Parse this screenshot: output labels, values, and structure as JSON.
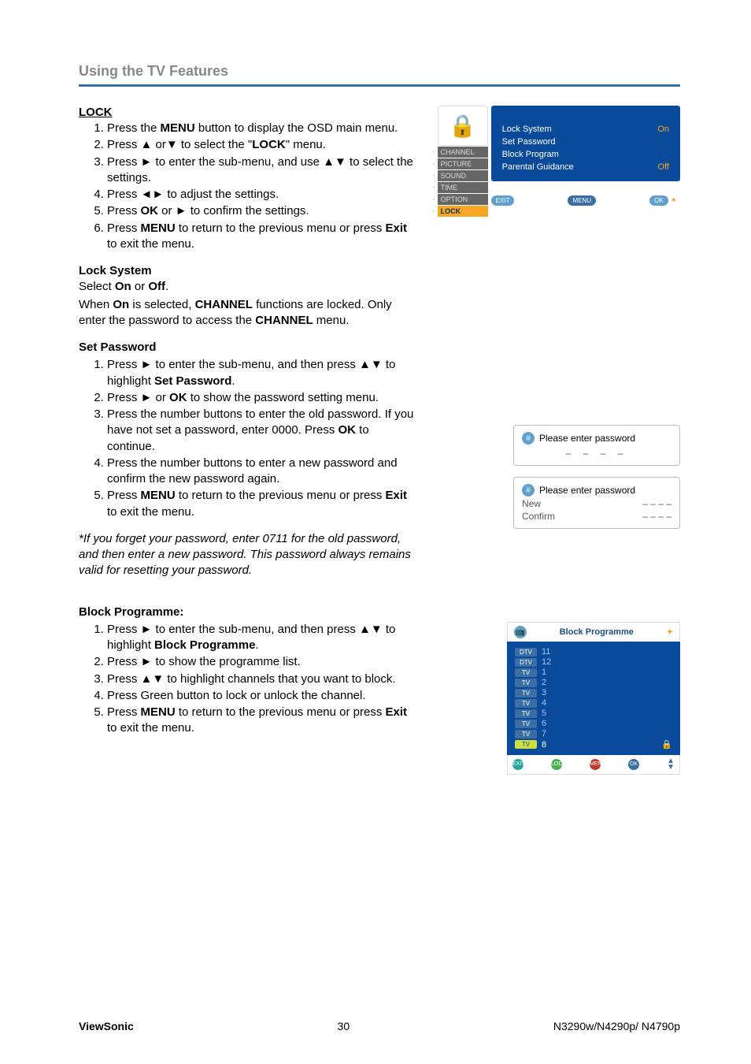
{
  "header": {
    "title": "Using the TV Features"
  },
  "lock": {
    "heading": "LOCK",
    "steps": [
      "Press the MENU button to display the OSD main menu.",
      "Press ▲ or▼ to select the \"LOCK\" menu.",
      "Press ► to enter the sub-menu, and use ▲▼ to select the settings.",
      "Press ◄► to adjust the settings.",
      "Press OK or ► to confirm the settings.",
      "Press MENU to return to the previous menu or press Exit to exit the menu."
    ]
  },
  "lockSystem": {
    "heading": "Lock System",
    "line1": "Select On or Off.",
    "line2": "When On is selected, CHANNEL functions are locked. Only enter the password to access the CHANNEL menu."
  },
  "setPassword": {
    "heading": "Set Password",
    "steps": [
      "Press ► to enter the sub-menu, and then press ▲▼ to highlight Set Password.",
      "Press ► or OK to show the password setting menu.",
      "Press the number buttons to enter the old password. If you have not set a password, enter 0000. Press OK to continue.",
      "Press the number buttons to enter a new password and confirm the new password again.",
      "Press MENU to return to the previous menu or press Exit to exit the menu."
    ],
    "note": "*If you forget your password, enter 0711 for the old password, and then enter a new password. This password always remains valid for resetting your password."
  },
  "blockProgramme": {
    "heading": "Block Programme:",
    "steps": [
      "Press ► to enter the sub-menu, and then press ▲▼ to highlight Block Programme.",
      "Press ► to show the programme list.",
      "Press ▲▼ to highlight channels that you want to block.",
      "Press Green button to lock or unlock the channel.",
      "Press MENU to return to the previous menu or press Exit to exit the menu."
    ]
  },
  "osd": {
    "side": [
      "CHANNEL",
      "PICTURE",
      "SOUND",
      "TIME",
      "OPTION",
      "LOCK"
    ],
    "main": {
      "rows": [
        {
          "label": "Lock System",
          "value": "On"
        },
        {
          "label": "Set Password",
          "value": ""
        },
        {
          "label": "Block Program",
          "value": ""
        },
        {
          "label": "Parental Guidance",
          "value": "Off"
        }
      ]
    },
    "foot": {
      "exit": "EXIT",
      "menu": "MENU",
      "ok": "OK"
    }
  },
  "pw1": {
    "title": "Please enter password",
    "dashes": "– – – –"
  },
  "pw2": {
    "title": "Please enter password",
    "rows": [
      {
        "label": "New",
        "dashes": "– – – –"
      },
      {
        "label": "Confirm",
        "dashes": "– – – –"
      }
    ]
  },
  "bp": {
    "title": "Block Programme",
    "items": [
      {
        "tag": "DTV",
        "num": "11"
      },
      {
        "tag": "DTV",
        "num": "12"
      },
      {
        "tag": "TV",
        "num": "1"
      },
      {
        "tag": "TV",
        "num": "2"
      },
      {
        "tag": "TV",
        "num": "3"
      },
      {
        "tag": "TV",
        "num": "4"
      },
      {
        "tag": "TV",
        "num": "5"
      },
      {
        "tag": "TV",
        "num": "6"
      },
      {
        "tag": "TV",
        "num": "7"
      },
      {
        "tag": "TV",
        "num": "8",
        "active": true,
        "locked": true
      }
    ],
    "foot": {
      "exit": "EXIT",
      "lock": "LOCK",
      "menu": "MENU",
      "ok": "OK"
    }
  },
  "footer": {
    "left": "ViewSonic",
    "center": "30",
    "right": "N3290w/N4290p/ N4790p"
  }
}
